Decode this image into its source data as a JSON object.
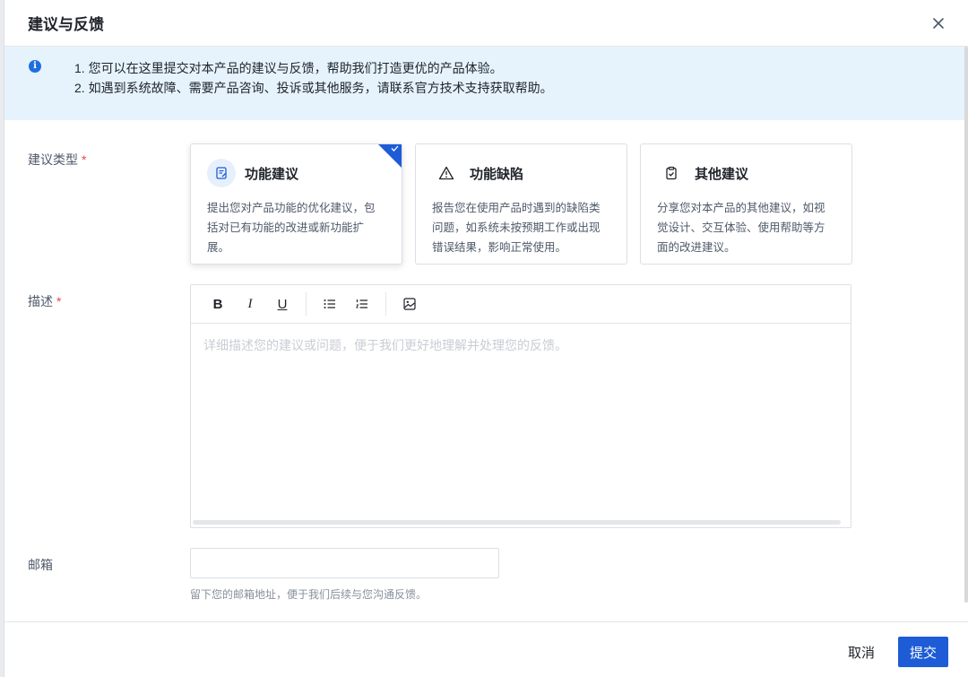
{
  "modal": {
    "title": "建议与反馈",
    "close_icon": "close-icon"
  },
  "notice": {
    "line1": "1. 您可以在这里提交对本产品的建议与反馈，帮助我们打造更优的产品体验。",
    "line2": "2. 如遇到系统故障、需要产品咨询、投诉或其他服务，请联系官方技术支持获取帮助。"
  },
  "form": {
    "type_label": "建议类型",
    "required_mark": "*",
    "types": [
      {
        "title": "功能建议",
        "desc": "提出您对产品功能的优化建议，包括对已有功能的改进或新功能扩展。",
        "icon": "edit-document-icon",
        "selected": true
      },
      {
        "title": "功能缺陷",
        "desc": "报告您在使用产品时遇到的缺陷类问题，如系统未按预期工作或出现错误结果，影响正常使用。",
        "icon": "warning-icon",
        "selected": false
      },
      {
        "title": "其他建议",
        "desc": "分享您对本产品的其他建议，如视觉设计、交互体验、使用帮助等方面的改进建议。",
        "icon": "clipboard-check-icon",
        "selected": false
      }
    ],
    "desc_label": "描述",
    "desc_placeholder": "详细描述您的建议或问题，便于我们更好地理解并处理您的反馈。",
    "toolbar": {
      "bold": "B",
      "italic": "I",
      "underline": "U"
    },
    "email_label": "邮箱",
    "email_value": "",
    "email_hint": "留下您的邮箱地址，便于我们后续与您沟通反馈。"
  },
  "footer": {
    "cancel_label": "取消",
    "submit_label": "提交"
  },
  "colors": {
    "primary": "#1d5cd6",
    "notice_bg": "#e6f3fd",
    "required": "#e5484d"
  }
}
